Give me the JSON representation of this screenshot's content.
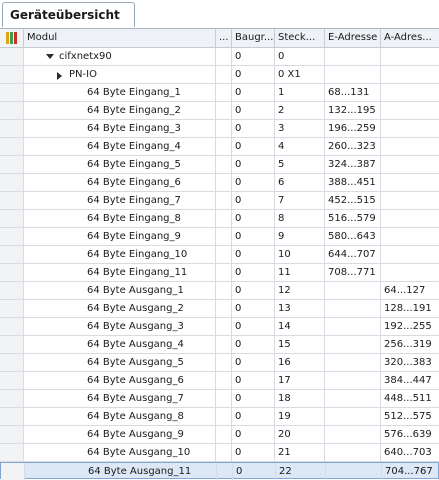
{
  "window": {
    "tab_label": "Geräteübersicht"
  },
  "columns": {
    "modul": "Modul",
    "dots": "...",
    "baugruppentraeger": "Baugr...",
    "steckplatz": "Steck...",
    "e_adresse": "E-Adresse",
    "a_adresse": "A-Adres..."
  },
  "rows": [
    {
      "modul": "cifxnetx90",
      "baugr": "0",
      "steck": "0",
      "e": "",
      "a": "",
      "level": 1,
      "toggle": "expanded"
    },
    {
      "modul": "PN-IO",
      "baugr": "0",
      "steck": "0 X1",
      "e": "",
      "a": "",
      "level": 2,
      "toggle": "collapsed"
    },
    {
      "modul": "64 Byte Eingang_1",
      "baugr": "0",
      "steck": "1",
      "e": "68...131",
      "a": ""
    },
    {
      "modul": "64 Byte Eingang_2",
      "baugr": "0",
      "steck": "2",
      "e": "132...195",
      "a": ""
    },
    {
      "modul": "64 Byte Eingang_3",
      "baugr": "0",
      "steck": "3",
      "e": "196...259",
      "a": ""
    },
    {
      "modul": "64 Byte Eingang_4",
      "baugr": "0",
      "steck": "4",
      "e": "260...323",
      "a": ""
    },
    {
      "modul": "64 Byte Eingang_5",
      "baugr": "0",
      "steck": "5",
      "e": "324...387",
      "a": ""
    },
    {
      "modul": "64 Byte Eingang_6",
      "baugr": "0",
      "steck": "6",
      "e": "388...451",
      "a": ""
    },
    {
      "modul": "64 Byte Eingang_7",
      "baugr": "0",
      "steck": "7",
      "e": "452...515",
      "a": ""
    },
    {
      "modul": "64 Byte Eingang_8",
      "baugr": "0",
      "steck": "8",
      "e": "516...579",
      "a": ""
    },
    {
      "modul": "64 Byte Eingang_9",
      "baugr": "0",
      "steck": "9",
      "e": "580...643",
      "a": ""
    },
    {
      "modul": "64 Byte Eingang_10",
      "baugr": "0",
      "steck": "10",
      "e": "644...707",
      "a": ""
    },
    {
      "modul": "64 Byte Eingang_11",
      "baugr": "0",
      "steck": "11",
      "e": "708...771",
      "a": ""
    },
    {
      "modul": "64 Byte Ausgang_1",
      "baugr": "0",
      "steck": "12",
      "e": "",
      "a": "64...127"
    },
    {
      "modul": "64 Byte Ausgang_2",
      "baugr": "0",
      "steck": "13",
      "e": "",
      "a": "128...191"
    },
    {
      "modul": "64 Byte Ausgang_3",
      "baugr": "0",
      "steck": "14",
      "e": "",
      "a": "192...255"
    },
    {
      "modul": "64 Byte Ausgang_4",
      "baugr": "0",
      "steck": "15",
      "e": "",
      "a": "256...319"
    },
    {
      "modul": "64 Byte Ausgang_5",
      "baugr": "0",
      "steck": "16",
      "e": "",
      "a": "320...383"
    },
    {
      "modul": "64 Byte Ausgang_6",
      "baugr": "0",
      "steck": "17",
      "e": "",
      "a": "384...447"
    },
    {
      "modul": "64 Byte Ausgang_7",
      "baugr": "0",
      "steck": "18",
      "e": "",
      "a": "448...511"
    },
    {
      "modul": "64 Byte Ausgang_8",
      "baugr": "0",
      "steck": "19",
      "e": "",
      "a": "512...575"
    },
    {
      "modul": "64 Byte Ausgang_9",
      "baugr": "0",
      "steck": "20",
      "e": "",
      "a": "576...639"
    },
    {
      "modul": "64 Byte Ausgang_10",
      "baugr": "0",
      "steck": "21",
      "e": "",
      "a": "640...703"
    },
    {
      "modul": "64 Byte Ausgang_11",
      "baugr": "0",
      "steck": "22",
      "e": "",
      "a": "704...767",
      "selected": true
    }
  ]
}
